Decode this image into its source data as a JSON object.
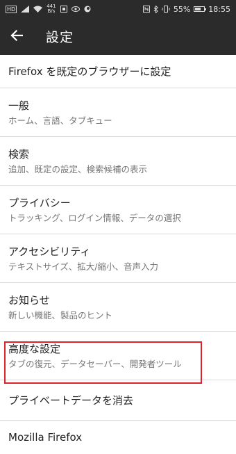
{
  "status_bar": {
    "hd": "HD",
    "net_speed_value": "441",
    "net_speed_unit": "B/s",
    "battery": "55%",
    "time": "18:55"
  },
  "app_bar": {
    "back_icon": "arrow-back-icon",
    "title": "設定"
  },
  "settings": [
    {
      "id": "default-browser",
      "title": "Firefox を既定のブラウザーに設定",
      "summary": ""
    },
    {
      "id": "general",
      "title": "一般",
      "summary": "ホーム、言語、タブキュー"
    },
    {
      "id": "search",
      "title": "検索",
      "summary": "追加、既定の設定、検索候補の表示"
    },
    {
      "id": "privacy",
      "title": "プライバシー",
      "summary": "トラッキング、ログイン情報、データの選択"
    },
    {
      "id": "accessibility",
      "title": "アクセシビリティ",
      "summary": "テキストサイズ、拡大/縮小、音声入力"
    },
    {
      "id": "notifications",
      "title": "お知らせ",
      "summary": "新しい機能、製品のヒント"
    },
    {
      "id": "advanced",
      "title": "高度な設定",
      "summary": "タブの復元、データセーバー、開発者ツール"
    },
    {
      "id": "clear-private-data",
      "title": "プライベートデータを消去",
      "summary": ""
    },
    {
      "id": "mozilla-firefox",
      "title": "Mozilla Firefox",
      "summary": ""
    }
  ],
  "highlight_color": "#e0202a"
}
